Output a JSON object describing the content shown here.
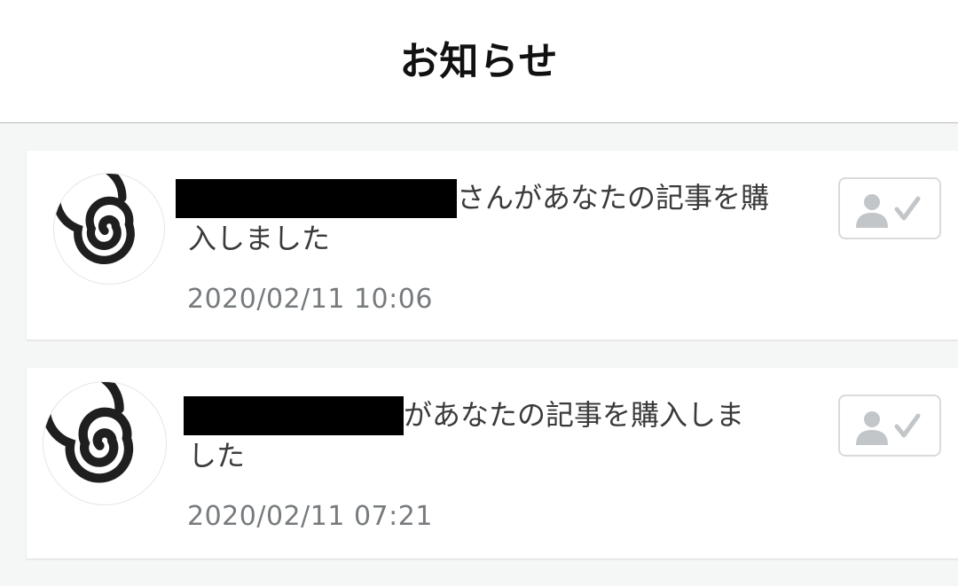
{
  "header": {
    "title": "お知らせ"
  },
  "notifications": [
    {
      "message_text": "さんがあなたの記事を購",
      "message_line2": "入しました",
      "timestamp": "2020/02/11 10:06",
      "avatar_icon": "spiral-icon",
      "action_icon": "follow-check-icon"
    },
    {
      "message_text": "があなたの記事を購入しま",
      "message_line2": "した",
      "timestamp": "2020/02/11 07:21",
      "avatar_icon": "spiral-icon",
      "action_icon": "follow-check-icon"
    }
  ],
  "colors": {
    "background": "#f5f6f6",
    "card": "#ffffff",
    "text": "#3a3a3a",
    "muted": "#777b7e",
    "icon_gray": "#c3c6c8"
  }
}
